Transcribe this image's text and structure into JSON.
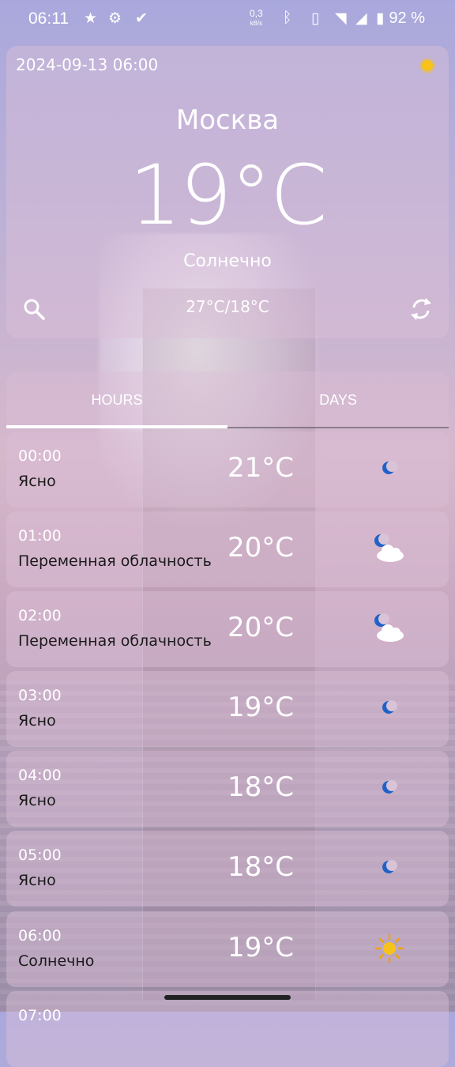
{
  "status_bar": {
    "time": "06:11",
    "speed_value": "0,3",
    "speed_unit": "kB/s",
    "battery": "92 %"
  },
  "current": {
    "datetime": "2024-09-13 06:00",
    "city": "Москва",
    "temperature": "19°C",
    "condition": "Солнечно",
    "minmax": "27°C/18°C",
    "icon": "sun-icon"
  },
  "tabs": {
    "hours": "HOURS",
    "days": "DAYS",
    "active": "hours"
  },
  "hours": [
    {
      "time": "00:00",
      "desc": "Ясно",
      "temp": "21°C",
      "icon": "moon-icon"
    },
    {
      "time": "01:00",
      "desc": "Переменная облачность",
      "temp": "20°C",
      "icon": "moon-cloud-icon"
    },
    {
      "time": "02:00",
      "desc": "Переменная облачность",
      "temp": "20°C",
      "icon": "moon-cloud-icon"
    },
    {
      "time": "03:00",
      "desc": "Ясно",
      "temp": "19°C",
      "icon": "moon-icon"
    },
    {
      "time": "04:00",
      "desc": "Ясно",
      "temp": "18°C",
      "icon": "moon-icon"
    },
    {
      "time": "05:00",
      "desc": "Ясно",
      "temp": "18°C",
      "icon": "moon-icon"
    },
    {
      "time": "06:00",
      "desc": "Солнечно",
      "temp": "19°C",
      "icon": "sun-icon"
    },
    {
      "time": "07:00",
      "desc": "",
      "temp": "",
      "icon": ""
    }
  ],
  "colors": {
    "accent": "#ffffff",
    "moon": "#1e62c8",
    "sun": "#f7c21a"
  }
}
